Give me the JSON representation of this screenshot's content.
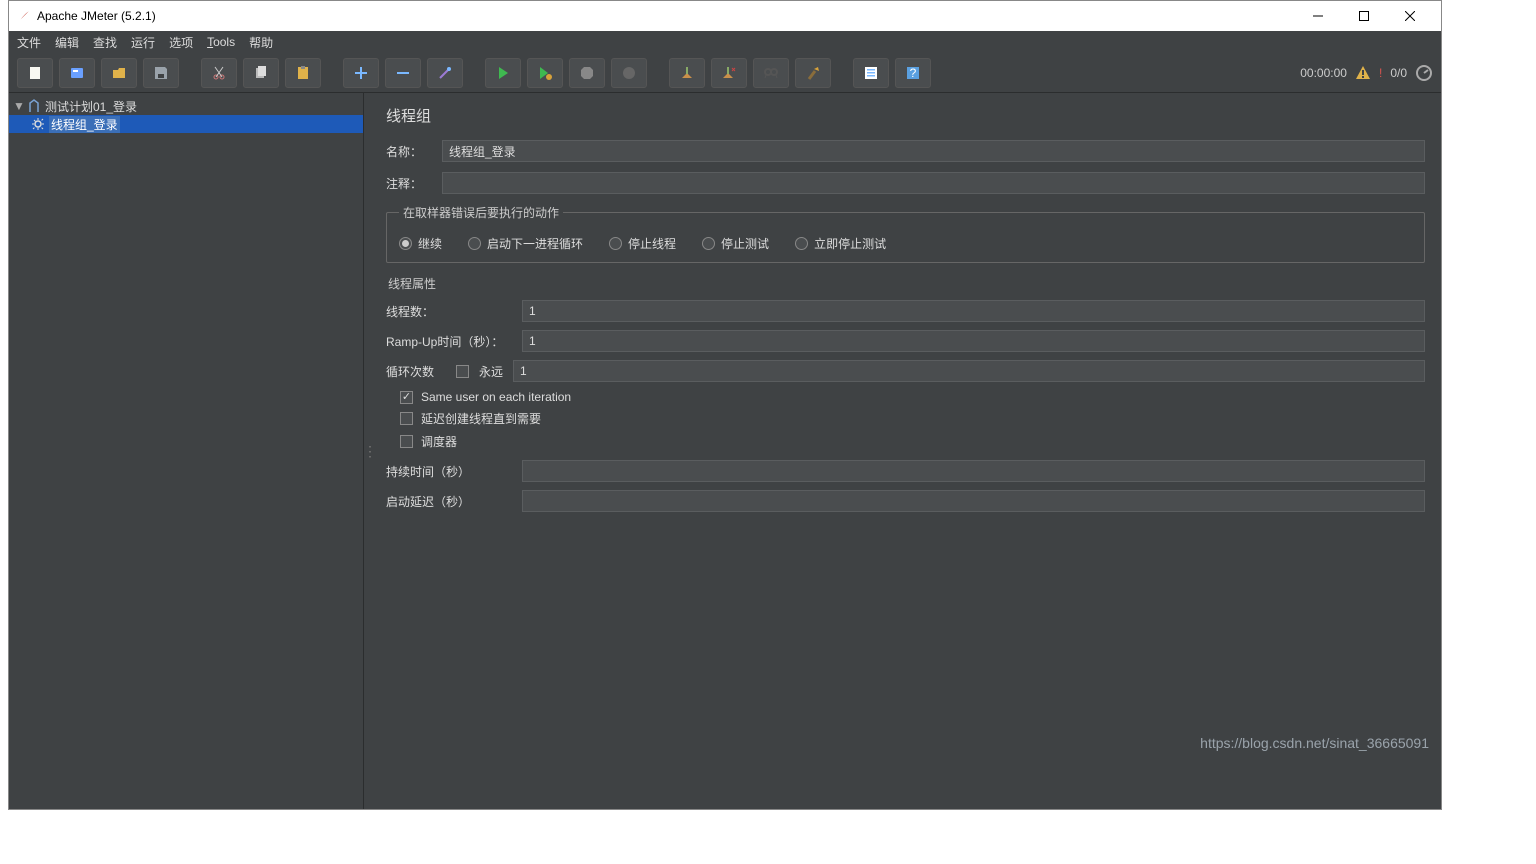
{
  "window": {
    "title": "Apache JMeter (5.2.1)"
  },
  "menu": {
    "file": "文件",
    "edit": "编辑",
    "search": "查找",
    "run": "运行",
    "options": "选项",
    "tools": "Tools",
    "help": "帮助"
  },
  "status": {
    "time": "00:00:00",
    "warn_count": "!",
    "threads": "0/0"
  },
  "tree": {
    "root": "测试计划01_登录",
    "child": "线程组_登录"
  },
  "editor": {
    "title": "线程组",
    "name_label": "名称：",
    "name_value": "线程组_登录",
    "comment_label": "注释：",
    "comment_value": "",
    "error_group": "在取样器错误后要执行的动作",
    "radios": {
      "continue": "继续",
      "next_loop": "启动下一进程循环",
      "stop_thread": "停止线程",
      "stop_test": "停止测试",
      "stop_now": "立即停止测试"
    },
    "props_title": "线程属性",
    "threads_label": "线程数：",
    "threads_value": "1",
    "rampup_label": "Ramp-Up时间（秒）：",
    "rampup_value": "1",
    "loop_label": "循环次数",
    "forever_label": "永远",
    "loop_value": "1",
    "same_user": "Same user on each iteration",
    "delay_create": "延迟创建线程直到需要",
    "scheduler": "调度器",
    "duration_label": "持续时间（秒）",
    "duration_value": "",
    "startup_delay_label": "启动延迟（秒）",
    "startup_delay_value": ""
  },
  "watermark": "https://blog.csdn.net/sinat_36665091"
}
